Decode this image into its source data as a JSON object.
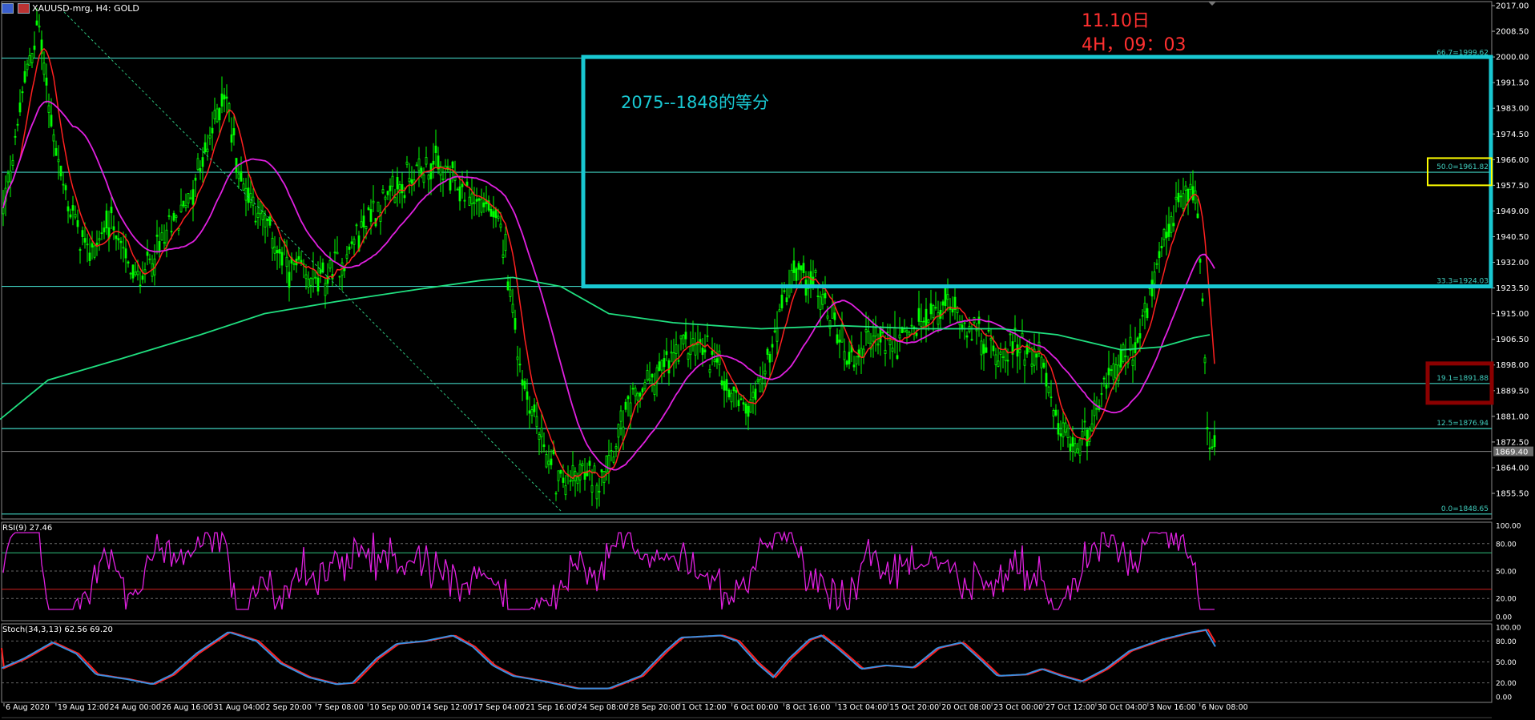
{
  "window": {
    "title": "XAUUSD-mrg, H4: GOLD"
  },
  "annotation": {
    "date": "11.10日",
    "timeframe": "4H，09：03",
    "box_label": "2075--1848的等分"
  },
  "colors": {
    "background": "#000000",
    "candle": "#00ff00",
    "ma_fast": "#ff2020",
    "ma_mid": "#e020e0",
    "ma_slow": "#20e080",
    "fib_line": "#40d0c0",
    "box": "#19c8d2",
    "rsi": "#e020e0",
    "stoch_main": "#3a8fe0",
    "stoch_signal": "#ff2020",
    "axis_text": "#ffffff",
    "yellow_box": "#ffff00",
    "darkred_box": "#8b0000"
  },
  "price_axis": {
    "labels": [
      "2017.00",
      "2008.50",
      "2000.00",
      "1991.50",
      "1983.00",
      "1974.50",
      "1966.00",
      "1957.50",
      "1949.00",
      "1940.50",
      "1932.00",
      "1923.50",
      "1915.00",
      "1906.50",
      "1898.00",
      "1889.50",
      "1881.00",
      "1872.50",
      "1864.00",
      "1855.50"
    ],
    "current_price": "1869.40"
  },
  "fib_levels": [
    {
      "label": "66.7=1999.62",
      "price": 1999.62
    },
    {
      "label": "50.0=1961.82",
      "price": 1961.82
    },
    {
      "label": "33.3=1924.03",
      "price": 1924.03
    },
    {
      "label": "19.1=1891.88",
      "price": 1891.88
    },
    {
      "label": "12.5=1876.94",
      "price": 1876.94
    },
    {
      "label": "0.0=1848.65",
      "price": 1848.65
    }
  ],
  "time_axis": {
    "labels": [
      "6 Aug 2020",
      "19 Aug 12:00",
      "24 Aug 00:00",
      "26 Aug 16:00",
      "31 Aug 04:00",
      "2 Sep 20:00",
      "7 Sep 08:00",
      "10 Sep 00:00",
      "14 Sep 12:00",
      "17 Sep 04:00",
      "21 Sep 16:00",
      "24 Sep 08:00",
      "28 Sep 20:00",
      "1 Oct 12:00",
      "6 Oct 00:00",
      "8 Oct 16:00",
      "13 Oct 04:00",
      "15 Oct 20:00",
      "20 Oct 08:00",
      "23 Oct 00:00",
      "27 Oct 12:00",
      "30 Oct 04:00",
      "3 Nov 16:00",
      "6 Nov 08:00"
    ]
  },
  "rsi_panel": {
    "label": "RSI(9) 27.46",
    "axis": [
      "100.00",
      "80.00",
      "50.00",
      "20.00",
      "0.00"
    ]
  },
  "stoch_panel": {
    "label": "Stoch(34,3,13) 62.56 69.20",
    "axis": [
      "100.00",
      "80.00",
      "50.00",
      "20.00",
      "0.00"
    ]
  }
}
